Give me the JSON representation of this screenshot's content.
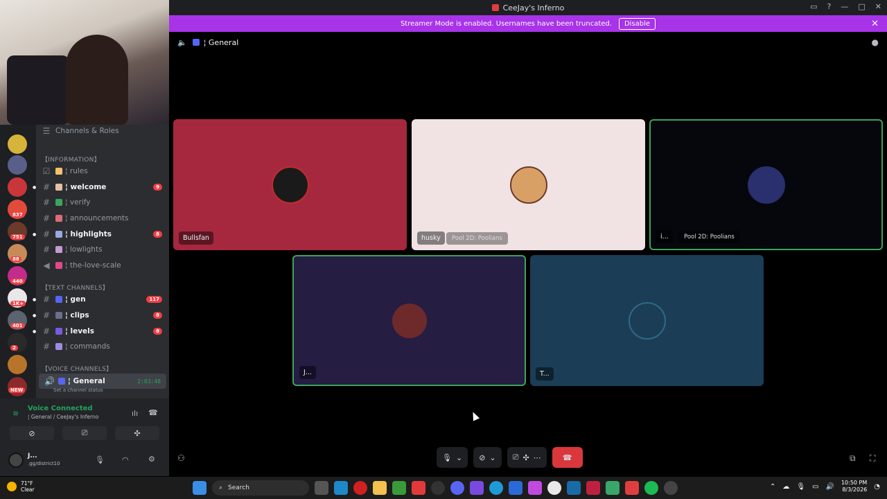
{
  "window": {
    "title": "CeeJay's Inferno",
    "controls": [
      "▭",
      "?",
      "—",
      "□",
      "✕"
    ]
  },
  "banner": {
    "text": "Streamer Mode is enabled. Usernames have been truncated.",
    "button": "Disable",
    "close": "✕"
  },
  "sidebar": {
    "header": "Channels & Roles",
    "categories": {
      "information": "【INFORMATION】",
      "text": "【TEXT CHANNELS】",
      "voice": "【VOICE CHANNELS】"
    },
    "channels": [
      {
        "label": "¦ rules",
        "unread": false,
        "badge": ""
      },
      {
        "label": "¦ welcome",
        "unread": true,
        "badge": "9"
      },
      {
        "label": "¦ verify",
        "unread": false,
        "badge": ""
      },
      {
        "label": "¦ announcements",
        "unread": false,
        "badge": ""
      },
      {
        "label": "¦ highlights",
        "unread": true,
        "badge": "8"
      },
      {
        "label": "¦ lowlights",
        "unread": false,
        "badge": ""
      },
      {
        "label": "¦ the-love-scale",
        "unread": false,
        "badge": ""
      },
      {
        "label": "¦ gen",
        "unread": true,
        "badge": "117"
      },
      {
        "label": "¦ clips",
        "unread": true,
        "badge": "8"
      },
      {
        "label": "¦ levels",
        "unread": true,
        "badge": "8"
      },
      {
        "label": "¦ commands",
        "unread": false,
        "badge": ""
      }
    ],
    "voice_channel": {
      "label": "¦ General",
      "timer": "2:03:48",
      "status": "Set a channel status"
    }
  },
  "servers": {
    "badges": [
      "837",
      "751",
      "88",
      "440",
      "1K+",
      "401",
      "2",
      "NEW"
    ]
  },
  "voice_panel": {
    "status": "Voice Connected",
    "location": "¦ General / CeeJay's Inferno",
    "user": "J...",
    "user_status": ".gg/district10"
  },
  "stage": {
    "channel": "¦ General",
    "tiles": [
      {
        "name": "Bullsfan",
        "activity": "",
        "bg": "#a6283e",
        "avatar": "#1a1a1a"
      },
      {
        "name": "husky",
        "activity": "Pool 2D: Poolians",
        "bg": "#f1e3e3",
        "avatar": "#d9a066"
      },
      {
        "name": "i...",
        "activity": "Pool 2D: Poolians",
        "bg": "#05070d",
        "avatar": "#2a2f6e"
      },
      {
        "name": "J...",
        "activity": "",
        "bg": "#251d42",
        "avatar": "#6e2a2a"
      },
      {
        "name": "T...",
        "activity": "",
        "bg": "#1b3d55",
        "avatar": "#1b3d55"
      }
    ]
  },
  "controls": {
    "mic": "🎙",
    "camera": "⊘",
    "screen": "⎚",
    "activities": "✣",
    "more": "⋯",
    "hangup": "☎"
  },
  "taskbar": {
    "temp": "71°F",
    "weather": "Clear",
    "search": "Search",
    "time": "10:50 PM",
    "date": "8/3/2026"
  }
}
